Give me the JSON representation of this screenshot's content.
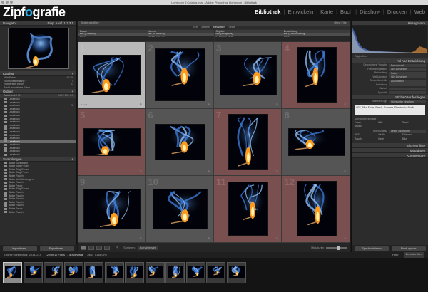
{
  "window": {
    "title": "Lightroom 5 Catalog.lrcat - Adobe Photoshop Lightroom - Bibliothek"
  },
  "brand": {
    "logo_pre": "Zipf",
    "logo_mid": "o",
    "logo_post": "grafie"
  },
  "modules": [
    {
      "label": "Bibliothek",
      "active": true
    },
    {
      "label": "Entwickeln",
      "active": false
    },
    {
      "label": "Karte",
      "active": false
    },
    {
      "label": "Buch",
      "active": false
    },
    {
      "label": "Diashow",
      "active": false
    },
    {
      "label": "Drucken",
      "active": false
    },
    {
      "label": "Web",
      "active": false
    }
  ],
  "left": {
    "navigator": {
      "title": "Navigator",
      "zoom": "Einp.  Ausf.  1:1  3:1"
    },
    "catalog": {
      "title": "Katalog",
      "items": [
        {
          "label": "Alle Fotos",
          "count": "41178"
        },
        {
          "label": "Schnellsammlung +",
          "count": "0"
        },
        {
          "label": "Vorheriger Import",
          "count": "41"
        },
        {
          "label": "Nicht exportierte Fotos",
          "count": ""
        }
      ]
    },
    "folders": {
      "title": "Ordner",
      "volume": {
        "label": "Macintosh HD",
        "count": "180 / 250 GB"
      },
      "items": [
        {
          "label": "Lesebuch",
          "count": ""
        },
        {
          "label": "Lesebuch",
          "count": ""
        },
        {
          "label": "Lesebuch",
          "count": "22"
        },
        {
          "label": "Lesebuch",
          "count": ""
        },
        {
          "label": "Lesebuch",
          "count": ""
        },
        {
          "label": "Lesebuch",
          "count": ""
        },
        {
          "label": "Lesebuch",
          "count": ""
        },
        {
          "label": "Lesebuch",
          "count": ""
        },
        {
          "label": "Lesebuch",
          "count": ""
        },
        {
          "label": "Lesebuch",
          "count": ""
        },
        {
          "label": "Lesebuch",
          "count": ""
        },
        {
          "label": "Lesebuch",
          "count": ""
        },
        {
          "label": "Lesebuch",
          "count": ""
        },
        {
          "label": "Lesebuch",
          "count": "14"
        },
        {
          "label": "Lesebuch",
          "count": ""
        },
        {
          "label": "Lesebuch",
          "count": ""
        },
        {
          "label": "Lesebuch",
          "count": ""
        },
        {
          "label": "Lesebuch",
          "count": ""
        }
      ]
    },
    "collections": {
      "title": "Sammlungen",
      "items": [
        {
          "label": "Bilder Schneiden",
          "count": ""
        },
        {
          "label": "Bilder Blog Feuer",
          "count": ""
        },
        {
          "label": "Bilder Blog Feuer",
          "count": ""
        },
        {
          "label": "Bilder Blog Feuer",
          "count": ""
        },
        {
          "label": "Bilder Rauch",
          "count": ""
        },
        {
          "label": "Bilder für Mitteilungen",
          "count": ""
        },
        {
          "label": "Bilder Rauch",
          "count": ""
        },
        {
          "label": "Bilder Feuer",
          "count": ""
        },
        {
          "label": "Bilder Blog Feuer",
          "count": ""
        },
        {
          "label": "Bilder Rauch",
          "count": ""
        },
        {
          "label": "Bilder Rauch",
          "count": ""
        },
        {
          "label": "Bilder Rauch",
          "count": ""
        },
        {
          "label": "Bilder Rauch",
          "count": ""
        },
        {
          "label": "Bilder Rauch",
          "count": ""
        },
        {
          "label": "Bilder Feuer",
          "count": ""
        },
        {
          "label": "Bilder Rauch",
          "count": ""
        }
      ]
    },
    "import_label": "Importieren...",
    "export_label": "Exportieren..."
  },
  "center": {
    "toolbar_top_left": "Bibliotheksfilter:",
    "toolbar_top_right": "Ohne Filter",
    "filter_tabs": [
      "Text",
      "Attribut",
      "Metadaten",
      "Ohne"
    ],
    "metadata_columns": [
      {
        "header": "Datum",
        "values": [
          "Alle (1 Datum)",
          "2013"
        ]
      },
      {
        "header": "Kamera",
        "values": [
          "Alle (1 Kamera)",
          "Canon EOS 7D"
        ]
      },
      {
        "header": "Objektiv",
        "values": [
          "Alle (1 Objektiv)",
          "EF100mm f/2.8L"
        ]
      },
      {
        "header": "Beschriftung",
        "values": [
          "Alle (1 Beschriftung)",
          "Ohne"
        ]
      }
    ],
    "cells": [
      {
        "num": "1",
        "highlight": "sel"
      },
      {
        "num": "2",
        "highlight": "none"
      },
      {
        "num": "3",
        "highlight": "none"
      },
      {
        "num": "4",
        "highlight": "red"
      },
      {
        "num": "5",
        "highlight": "red"
      },
      {
        "num": "6",
        "highlight": "none"
      },
      {
        "num": "7",
        "highlight": "red"
      },
      {
        "num": "8",
        "highlight": "none"
      },
      {
        "num": "9",
        "highlight": "none"
      },
      {
        "num": "10",
        "highlight": "none"
      },
      {
        "num": "11",
        "highlight": "red"
      },
      {
        "num": "12",
        "highlight": "red"
      }
    ],
    "sort_label": "Sortieren:",
    "sort_value": "Aufnahmezeit",
    "thumbs_label": "Miniaturen"
  },
  "right": {
    "histogram_title": "Histogramm",
    "histogram_info": "Originalfoto",
    "quick_dev_title": "Ad-hoc-Entwicklung",
    "quick_dev": [
      {
        "key": "Gespeicherte Vorgabe",
        "value": "Benutzerdef."
      },
      {
        "key": "Freistellungsfaktor",
        "value": "Wie Aufnahme"
      },
      {
        "key": "Behandlung",
        "value": "Farbe"
      },
      {
        "key": "Weißabgleich",
        "value": "Wie Aufnahme"
      },
      {
        "key": "Tonwertkontrolle",
        "value": "Automatisch"
      },
      {
        "key": "Belichtung",
        "value": ""
      },
      {
        "key": "Klarheit",
        "value": ""
      },
      {
        "key": "Dynamik",
        "value": ""
      }
    ],
    "keywords_title": "Stichwörter festlegen",
    "keyword_tags_label": "Stichwort-Tags",
    "keyword_tags_value": "Stichwörter eingeben",
    "keyword_box": "AFS, Blitz, Feuer, Rauch, Schwarz, Streichholz, Studio",
    "suggestions_title": "Stichwortvorschläge",
    "suggestions": [
      "Feuer",
      "Blitz",
      "Rauch",
      "Studio"
    ],
    "keyword_set_title": "Stichwortsatz",
    "keyword_set_value": "Letzte Stichwörter",
    "keyword_set_items": [
      "AFS",
      "Studio",
      "Schwarz",
      "Rauch",
      "Feuer",
      "Blitz"
    ],
    "keyword_list_title": "Stichwortliste",
    "metadata_title": "Metadaten",
    "comments_title": "Kommentare",
    "sync_label": "Synchronisieren",
    "sync_settings_label": "Einst. synchr."
  },
  "filmstrip": {
    "path": "Ordner: Streichholz_20131214",
    "count_info": "12 von 12 Fotos / 1 ausgewählt",
    "filename": "/IMG_5165.CR2",
    "filter_label": "Filter:",
    "filter_value": "Benutzerfilter",
    "thumb_count": 12,
    "selected_index": 0
  }
}
